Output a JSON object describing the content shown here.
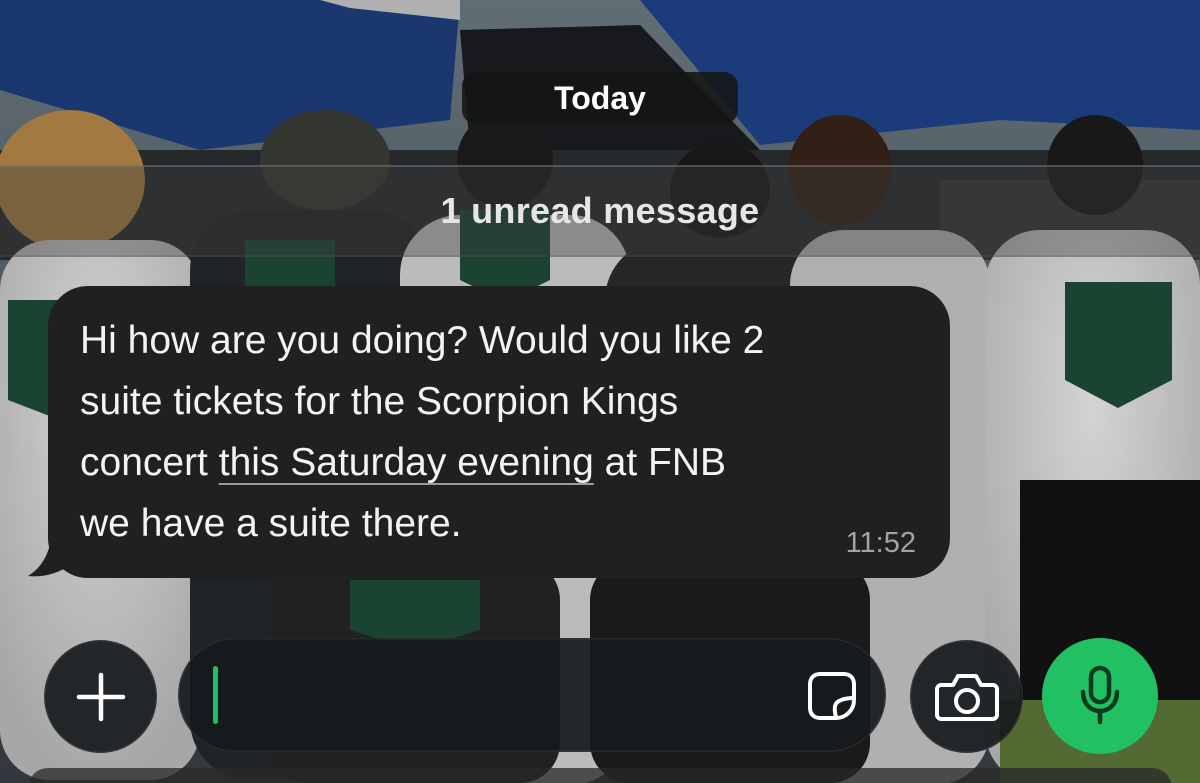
{
  "chat": {
    "date_separator": "Today",
    "unread_banner": "1 unread message",
    "messages": [
      {
        "text_before": "Hi how are you doing? Would you like 2\nsuite tickets for the Scorpion Kings\nconcert ",
        "date_link": "this Saturday evening",
        "text_after": " at FNB\nwe have a suite there.",
        "time": "11:52",
        "direction": "incoming"
      }
    ]
  },
  "composer": {
    "placeholder": "",
    "value": "",
    "attach_icon": "plus-icon",
    "sticker_icon": "sticker-icon",
    "camera_icon": "camera-icon",
    "mic_icon": "microphone-icon"
  },
  "theme": {
    "accent": "#21c063",
    "bubble": "#202020",
    "text": "#f3f3f3",
    "timestamp": "#a3a3a3"
  }
}
